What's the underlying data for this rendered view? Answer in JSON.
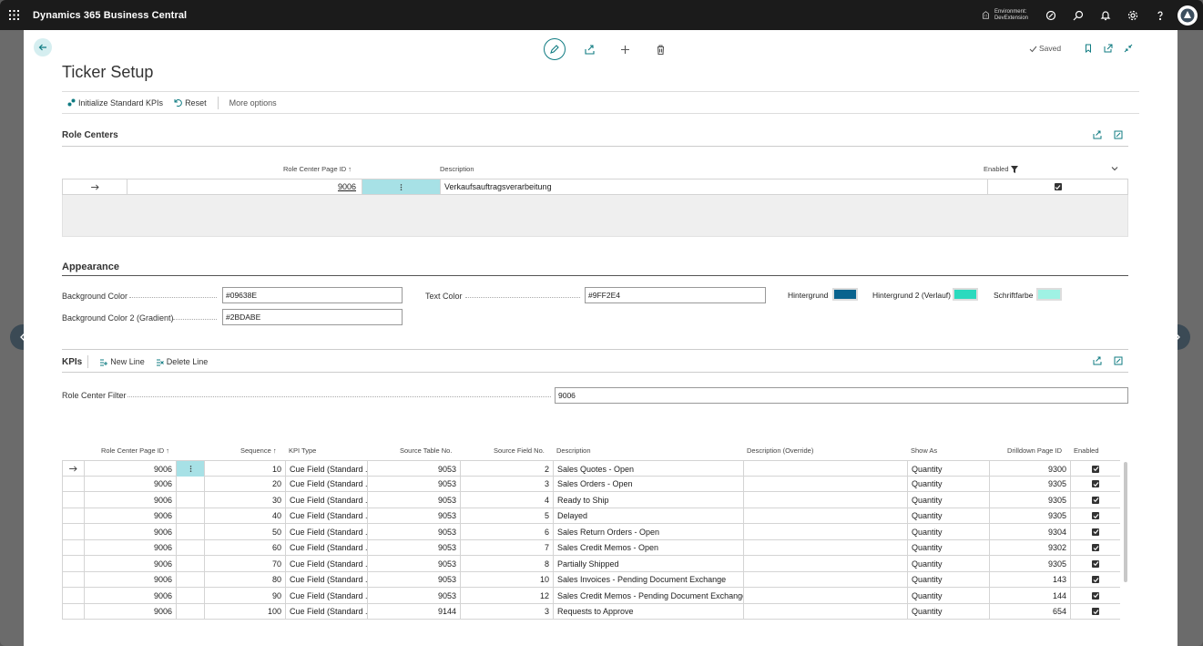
{
  "app": {
    "title": "Dynamics 365 Business Central",
    "environment_label": "Environment:",
    "environment_name": "DevExtension"
  },
  "page": {
    "title": "Ticker Setup",
    "saved_label": "Saved"
  },
  "actions": {
    "initialize": "Initialize Standard KPIs",
    "reset": "Reset",
    "more": "More options"
  },
  "role_centers": {
    "title": "Role Centers",
    "headers": {
      "page_id": "Role Center Page ID ↑",
      "description": "Description",
      "enabled": "Enabled"
    },
    "row": {
      "page_id": "9006",
      "description": "Verkaufsauftragsverarbeitung",
      "enabled": true
    }
  },
  "appearance": {
    "title": "Appearance",
    "bg_label": "Background Color",
    "bg_value": "#09638E",
    "bg2_label": "Background Color 2 (Gradient)",
    "bg2_value": "#2BDABE",
    "text_label": "Text Color",
    "text_value": "#9FF2E4",
    "swatch1_label": "Hintergrund",
    "swatch2_label": "Hintergrund 2 (Verlauf)",
    "swatch3_label": "Schriftfarbe",
    "colors": {
      "bg": "#09638E",
      "bg2": "#2BDABE",
      "text": "#9FF2E4"
    }
  },
  "kpis": {
    "title": "KPIs",
    "new_line": "New Line",
    "delete_line": "Delete Line",
    "filter_label": "Role Center Filter",
    "filter_value": "9006",
    "headers": [
      "Role Center Page ID ↑",
      "Sequence ↑",
      "KPI Type",
      "Source Table No.",
      "Source Field No.",
      "Description",
      "Description (Override)",
      "Show As",
      "Drilldown Page ID",
      "Enabled"
    ],
    "rows": [
      {
        "rc": "9006",
        "seq": "10",
        "type": "Cue Field (Standard ...",
        "table": "9053",
        "field": "2",
        "desc": "Sales Quotes - Open",
        "override": "",
        "show": "Quantity",
        "drill": "9300"
      },
      {
        "rc": "9006",
        "seq": "20",
        "type": "Cue Field (Standard ...",
        "table": "9053",
        "field": "3",
        "desc": "Sales Orders - Open",
        "override": "",
        "show": "Quantity",
        "drill": "9305"
      },
      {
        "rc": "9006",
        "seq": "30",
        "type": "Cue Field (Standard ...",
        "table": "9053",
        "field": "4",
        "desc": "Ready to Ship",
        "override": "",
        "show": "Quantity",
        "drill": "9305"
      },
      {
        "rc": "9006",
        "seq": "40",
        "type": "Cue Field (Standard ...",
        "table": "9053",
        "field": "5",
        "desc": "Delayed",
        "override": "",
        "show": "Quantity",
        "drill": "9305"
      },
      {
        "rc": "9006",
        "seq": "50",
        "type": "Cue Field (Standard ...",
        "table": "9053",
        "field": "6",
        "desc": "Sales Return Orders - Open",
        "override": "",
        "show": "Quantity",
        "drill": "9304"
      },
      {
        "rc": "9006",
        "seq": "60",
        "type": "Cue Field (Standard ...",
        "table": "9053",
        "field": "7",
        "desc": "Sales Credit Memos - Open",
        "override": "",
        "show": "Quantity",
        "drill": "9302"
      },
      {
        "rc": "9006",
        "seq": "70",
        "type": "Cue Field (Standard ...",
        "table": "9053",
        "field": "8",
        "desc": "Partially Shipped",
        "override": "",
        "show": "Quantity",
        "drill": "9305"
      },
      {
        "rc": "9006",
        "seq": "80",
        "type": "Cue Field (Standard ...",
        "table": "9053",
        "field": "10",
        "desc": "Sales Invoices - Pending Document Exchange",
        "override": "",
        "show": "Quantity",
        "drill": "143"
      },
      {
        "rc": "9006",
        "seq": "90",
        "type": "Cue Field (Standard ...",
        "table": "9053",
        "field": "12",
        "desc": "Sales Credit Memos - Pending Document Exchange",
        "override": "",
        "show": "Quantity",
        "drill": "144"
      },
      {
        "rc": "9006",
        "seq": "100",
        "type": "Cue Field (Standard ...",
        "table": "9144",
        "field": "3",
        "desc": "Requests to Approve",
        "override": "",
        "show": "Quantity",
        "drill": "654"
      }
    ]
  }
}
